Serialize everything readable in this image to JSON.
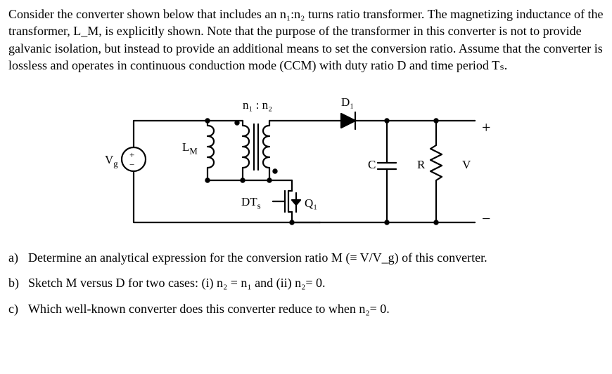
{
  "intro": "Consider the converter shown below that includes an n₁:n₂ turns ratio transformer. The magnetizing inductance of the transformer, L_M, is explicitly shown. Note that the purpose of the transformer in this converter is not to provide galvanic isolation, but instead to provide an additional means to set the conversion ratio. Assume that the converter is lossless and operates in continuous conduction mode (CCM) with duty ratio D and time period Tₛ.",
  "circuit": {
    "ratio": "n₁ : n₂",
    "D1": "D₁",
    "LM": "L",
    "LM_sub": "M",
    "Vg": "V",
    "Vg_sub": "g",
    "DTs": "DT",
    "DTs_sub": "s",
    "Q1": "Q₁",
    "C": "C",
    "R": "R",
    "V": "V",
    "plus": "+",
    "minus": "−",
    "src_plus": "+",
    "src_minus": "−"
  },
  "questions": {
    "a": {
      "label": "a)",
      "text": "Determine an analytical expression for the conversion ratio M (≡ V/V_g) of this converter."
    },
    "b": {
      "label": "b)",
      "text": "Sketch M versus D for two cases: (i) n₂ = n₁ and (ii) n₂= 0."
    },
    "c": {
      "label": "c)",
      "text": "Which well-known converter does this converter reduce to when n₂= 0."
    }
  }
}
